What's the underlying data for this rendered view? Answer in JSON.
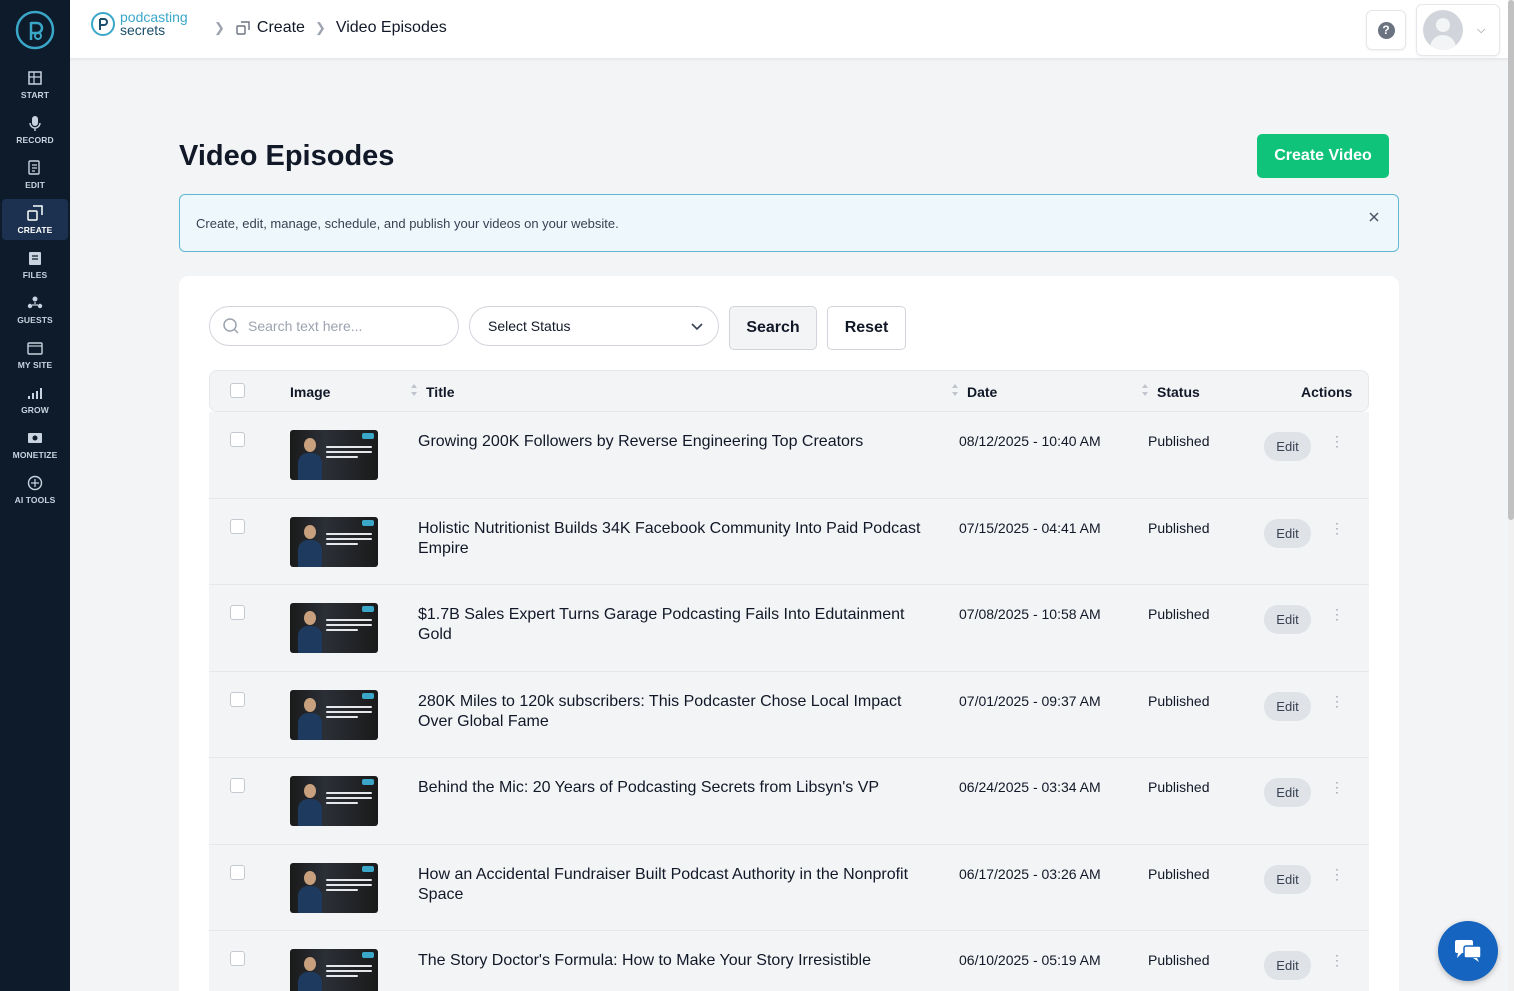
{
  "sidebar": {
    "items": [
      {
        "label": "START",
        "icon": "start-icon"
      },
      {
        "label": "RECORD",
        "icon": "microphone-icon"
      },
      {
        "label": "EDIT",
        "icon": "edit-icon"
      },
      {
        "label": "CREATE",
        "icon": "create-icon",
        "active": true
      },
      {
        "label": "FILES",
        "icon": "files-icon"
      },
      {
        "label": "GUESTS",
        "icon": "guests-icon"
      },
      {
        "label": "MY SITE",
        "icon": "mysite-icon"
      },
      {
        "label": "GROW",
        "icon": "grow-icon"
      },
      {
        "label": "MONETIZE",
        "icon": "monetize-icon"
      },
      {
        "label": "AI TOOLS",
        "icon": "ai-tools-icon"
      }
    ]
  },
  "header": {
    "brand_line1": "podcasting",
    "brand_line2": "secrets",
    "breadcrumb": [
      "Create",
      "Video Episodes"
    ],
    "help_glyph": "?"
  },
  "page": {
    "title": "Video Episodes",
    "create_button": "Create Video",
    "info_text": "Create, edit, manage, schedule, and publish your videos on your website."
  },
  "filters": {
    "search_placeholder": "Search text here...",
    "status_select": "Select Status",
    "search_button": "Search",
    "reset_button": "Reset"
  },
  "table": {
    "columns": {
      "image": "Image",
      "title": "Title",
      "date": "Date",
      "status": "Status",
      "actions": "Actions"
    },
    "edit_label": "Edit",
    "rows": [
      {
        "title": "Growing 200K Followers by Reverse Engineering Top Creators",
        "date": "08/12/2025 - 10:40 AM",
        "status": "Published"
      },
      {
        "title": "Holistic Nutritionist Builds 34K Facebook Community Into Paid Podcast Empire",
        "date": "07/15/2025 - 04:41 AM",
        "status": "Published"
      },
      {
        "title": "$1.7B Sales Expert Turns Garage Podcasting Fails Into Edutainment Gold",
        "date": "07/08/2025 - 10:58 AM",
        "status": "Published"
      },
      {
        "title": "280K Miles to 120k subscribers: This Podcaster Chose Local Impact Over Global Fame",
        "date": "07/01/2025 - 09:37 AM",
        "status": "Published"
      },
      {
        "title": "Behind the Mic: 20 Years of Podcasting Secrets from Libsyn's VP",
        "date": "06/24/2025 - 03:34 AM",
        "status": "Published"
      },
      {
        "title": "How an Accidental Fundraiser Built Podcast Authority in the Nonprofit Space",
        "date": "06/17/2025 - 03:26 AM",
        "status": "Published"
      },
      {
        "title": "The Story Doctor's Formula: How to Make Your Story Irresistible",
        "date": "06/10/2025 - 05:19 AM",
        "status": "Published"
      }
    ]
  },
  "colors": {
    "sidebar_bg": "#0d1b2a",
    "accent_green": "#10c37a",
    "info_border": "#5fb8d2",
    "chat_blue": "#1565c0"
  }
}
